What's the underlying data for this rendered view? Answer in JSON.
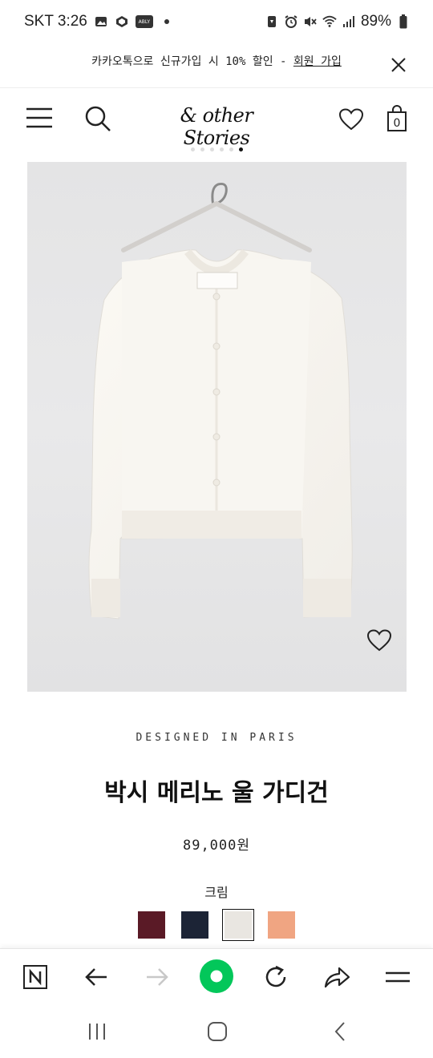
{
  "status_bar": {
    "carrier_time": "SKT 3:26",
    "battery": "89%",
    "ably_label": "ABLY",
    "icons": [
      "gallery-icon",
      "app-icon",
      "ably-icon",
      "dot-icon",
      "sync-icon",
      "alarm-icon",
      "mute-icon",
      "wifi-icon",
      "signal-icon",
      "battery-icon"
    ]
  },
  "promo": {
    "text": "카카오톡으로 신규가입 시 10% 할인 - ",
    "link": "회원 가입"
  },
  "header": {
    "logo": "& other Stories",
    "cart_count": "0",
    "icons": [
      "menu-icon",
      "search-icon",
      "heart-icon",
      "bag-icon"
    ]
  },
  "carousel": {
    "total": 6,
    "active_index": 5
  },
  "product": {
    "tagline": "DESIGNED IN PARIS",
    "title": "박시 메리노 울 가디건",
    "price": "89,000원",
    "selected_color": "크림",
    "swatches": [
      {
        "color": "#5a1a26",
        "selected": false
      },
      {
        "color": "#1c2436",
        "selected": false
      },
      {
        "color": "#e9e6e1",
        "selected": true
      },
      {
        "color": "#f0a582",
        "selected": false
      }
    ]
  },
  "browser_toolbar": {
    "icons": [
      "naver-icon",
      "back-arrow-icon",
      "forward-arrow-icon",
      "home-green-icon",
      "refresh-icon",
      "share-icon",
      "menu-lines-icon"
    ]
  },
  "system_nav": {
    "icons": [
      "recents-icon",
      "home-icon",
      "back-icon"
    ]
  },
  "colors": {
    "accent_green": "#03c75a",
    "image_bg": "#e6e6e7",
    "text": "#111111"
  }
}
